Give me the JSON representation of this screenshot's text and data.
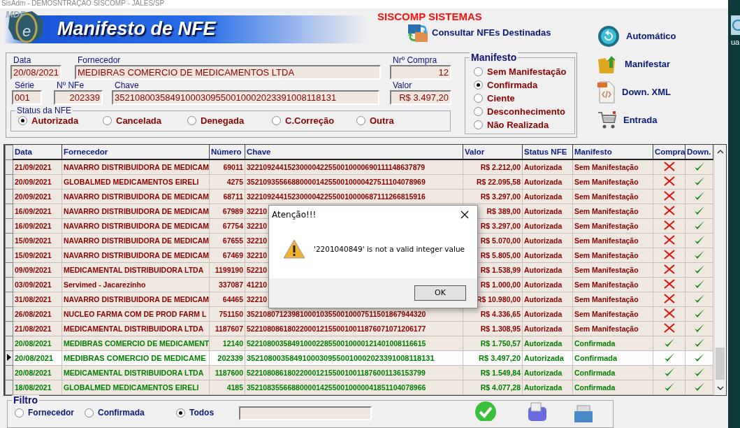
{
  "window": {
    "title": "SisAdm  - DEMOSNTRAÇÃO SISCOMP - JALES/SP"
  },
  "header": {
    "logo_text": "MDF",
    "logo_letter": "e",
    "title": "Manifesto de NFE",
    "company": "SISCOMP SISTEMAS",
    "consult_button": "Consultar NFEs Destinadas"
  },
  "actions": [
    {
      "label": "Automático",
      "kind": "sync"
    },
    {
      "label": "Manifestar",
      "kind": "folder"
    },
    {
      "label": "Down. XML",
      "kind": "xml"
    },
    {
      "label": "Entrada",
      "kind": "cart"
    }
  ],
  "form": {
    "data": {
      "label": "Data",
      "value": "20/08/2021"
    },
    "fornecedor": {
      "label": "Fornecedor",
      "value": "MEDIBRAS COMERCIO DE MEDICAMENTOS LTDA"
    },
    "nr_compra": {
      "label": "Nrº Compra",
      "value": "12"
    },
    "serie": {
      "label": "Série",
      "value": "001"
    },
    "nr_nfe": {
      "label": "Nº NFe",
      "value": "202339"
    },
    "chave": {
      "label": "Chave",
      "value": "35210800358491000309550010002023391008118131"
    },
    "valor": {
      "label": "Valor",
      "value": "R$ 3.497,20"
    }
  },
  "status_nfe": {
    "title": "Status da NFE",
    "options": [
      {
        "label": "Autorizada",
        "selected": true
      },
      {
        "label": "Cancelada",
        "selected": false
      },
      {
        "label": "Denegada",
        "selected": false
      },
      {
        "label": "C.Correção",
        "selected": false
      },
      {
        "label": "Outra",
        "selected": false
      }
    ]
  },
  "manifesto": {
    "title": "Manifesto",
    "options": [
      {
        "label": "Sem Manifestação",
        "selected": false
      },
      {
        "label": "Confirmada",
        "selected": true
      },
      {
        "label": "Ciente",
        "selected": false
      },
      {
        "label": "Desconhecimento",
        "selected": false
      },
      {
        "label": "Não Realizada",
        "selected": false
      }
    ]
  },
  "table": {
    "columns": [
      "Data",
      "Fornecedor",
      "Número",
      "Chave",
      "Valor",
      "Status NFE",
      "Manifesto",
      "Compra",
      "Down."
    ],
    "rows": [
      {
        "data": "21/09/2021",
        "fornecedor": "NAVARRO DISTRIBUIDORA DE MEDICAM",
        "numero": "69011",
        "chave": "32210924415230000422550010000690111148637879",
        "valor": "R$ 2.212,00",
        "status": "Autorizada",
        "manifesto": "Sem Manifestação",
        "compra": false,
        "down": true,
        "color": "#8b0000",
        "selected": false
      },
      {
        "data": "20/09/2021",
        "fornecedor": "GLOBALMED MEDICAMENTOS EIRELI",
        "numero": "4275",
        "chave": "35210935566880000142550010000427511104078969",
        "valor": "R$ 22.095,58",
        "status": "Autorizada",
        "manifesto": "Sem Manifestação",
        "compra": false,
        "down": true,
        "color": "#8b0000",
        "selected": false
      },
      {
        "data": "20/09/2021",
        "fornecedor": "NAVARRO DISTRIBUIDORA DE MEDICAM",
        "numero": "68711",
        "chave": "32210924415230000422550010000687111266815916",
        "valor": "R$ 3.297,00",
        "status": "Autorizada",
        "manifesto": "Sem Manifestação",
        "compra": false,
        "down": true,
        "color": "#8b0000",
        "selected": false
      },
      {
        "data": "16/09/2021",
        "fornecedor": "NAVARRO DISTRIBUIDORA DE MEDICAM",
        "numero": "67989",
        "chave": "32210",
        "valor": "R$ 389,00",
        "status": "Autorizada",
        "manifesto": "Sem Manifestação",
        "compra": false,
        "down": true,
        "color": "#8b0000",
        "selected": false
      },
      {
        "data": "16/09/2021",
        "fornecedor": "NAVARRO DISTRIBUIDORA DE MEDICAM",
        "numero": "67754",
        "chave": "32210",
        "valor": "R$ 3.297,00",
        "status": "Autorizada",
        "manifesto": "Sem Manifestação",
        "compra": false,
        "down": true,
        "color": "#8b0000",
        "selected": false
      },
      {
        "data": "15/09/2021",
        "fornecedor": "NAVARRO DISTRIBUIDORA DE MEDICAM",
        "numero": "67655",
        "chave": "32210",
        "valor": "R$ 5.070,00",
        "status": "Autorizada",
        "manifesto": "Sem Manifestação",
        "compra": false,
        "down": true,
        "color": "#8b0000",
        "selected": false
      },
      {
        "data": "15/09/2021",
        "fornecedor": "NAVARRO DISTRIBUIDORA DE MEDICAM",
        "numero": "67469",
        "chave": "32210",
        "valor": "R$ 5.805,00",
        "status": "Autorizada",
        "manifesto": "Sem Manifestação",
        "compra": false,
        "down": true,
        "color": "#8b0000",
        "selected": false
      },
      {
        "data": "09/09/2021",
        "fornecedor": "MEDICAMENTAL DISTRIBUIDORA LTDA",
        "numero": "1199190",
        "chave": "52210",
        "valor": "R$ 1.538,99",
        "status": "Autorizada",
        "manifesto": "Sem Manifestação",
        "compra": false,
        "down": true,
        "color": "#8b0000",
        "selected": false
      },
      {
        "data": "03/09/2021",
        "fornecedor": "Servimed - Jacarezinho",
        "numero": "337087",
        "chave": "41210",
        "valor": "R$ 1.000,00",
        "status": "Autorizada",
        "manifesto": "Sem Manifestação",
        "compra": false,
        "down": true,
        "color": "#8b0000",
        "selected": false
      },
      {
        "data": "31/08/2021",
        "fornecedor": "NAVARRO DISTRIBUIDORA DE MEDICAM",
        "numero": "64465",
        "chave": "32210",
        "valor": "R$ 10.980,00",
        "status": "Autorizada",
        "manifesto": "Sem Manifestação",
        "compra": false,
        "down": true,
        "color": "#8b0000",
        "selected": false
      },
      {
        "data": "26/08/2021",
        "fornecedor": "NUCLEO FARMA COM DE PROD FARM L",
        "numero": "751150",
        "chave": "35210807123981000103550010007511501867944320",
        "valor": "R$ 4.336,65",
        "status": "Autorizada",
        "manifesto": "Sem Manifestação",
        "compra": false,
        "down": true,
        "color": "#8b0000",
        "selected": false
      },
      {
        "data": "21/08/2021",
        "fornecedor": "MEDICAMENTAL DISTRIBUIDORA LTDA",
        "numero": "1187607",
        "chave": "52210808618022000121550010011876071071206177",
        "valor": "R$ 1.308,95",
        "status": "Autorizada",
        "manifesto": "Sem Manifestação",
        "compra": false,
        "down": true,
        "color": "#8b0000",
        "selected": false
      },
      {
        "data": "20/08/2021",
        "fornecedor": "MEDIBRAS COMERCIO DE MEDICAMENT",
        "numero": "12140",
        "chave": "52210800358491000228550010000121401008116615",
        "valor": "R$ 1.750,57",
        "status": "Autorizada",
        "manifesto": "Confirmada",
        "compra": true,
        "down": true,
        "color": "#008000",
        "selected": false
      },
      {
        "data": "20/08/2021",
        "fornecedor": "MEDIBRAS COMERCIO DE MEDICAME",
        "numero": "202339",
        "chave": "35210800358491000309550010002023391008118131",
        "valor": "R$ 3.497,20",
        "status": "Autorizada",
        "manifesto": "Confirmada",
        "compra": true,
        "down": true,
        "color": "#008000",
        "selected": true
      },
      {
        "data": "20/08/2021",
        "fornecedor": "MEDICAMENTAL DISTRIBUIDORA LTDA",
        "numero": "1187600",
        "chave": "52210808618022000121550010011876001136153799",
        "valor": "R$ 1.549,84",
        "status": "Autorizada",
        "manifesto": "Confirmada",
        "compra": true,
        "down": true,
        "color": "#008000",
        "selected": false
      },
      {
        "data": "18/08/2021",
        "fornecedor": "GLOBALMED MEDICAMENTOS EIRELI",
        "numero": "4185",
        "chave": "35210835566880000142550010000041851104078966",
        "valor": "R$ 4.077,28",
        "status": "Autorizada",
        "manifesto": "Confirmada",
        "compra": true,
        "down": true,
        "color": "#008000",
        "selected": false
      }
    ]
  },
  "dialog": {
    "title": "Atenção!!!",
    "message": "'2201040849' is not a valid integer value",
    "button": "OK"
  },
  "filter": {
    "title": "Filtro",
    "options": [
      {
        "label": "Fornecedor",
        "selected": false
      },
      {
        "label": "Confirmada",
        "selected": false
      },
      {
        "label": "Todos",
        "selected": true
      }
    ]
  },
  "desktop": {
    "label": "ua"
  }
}
